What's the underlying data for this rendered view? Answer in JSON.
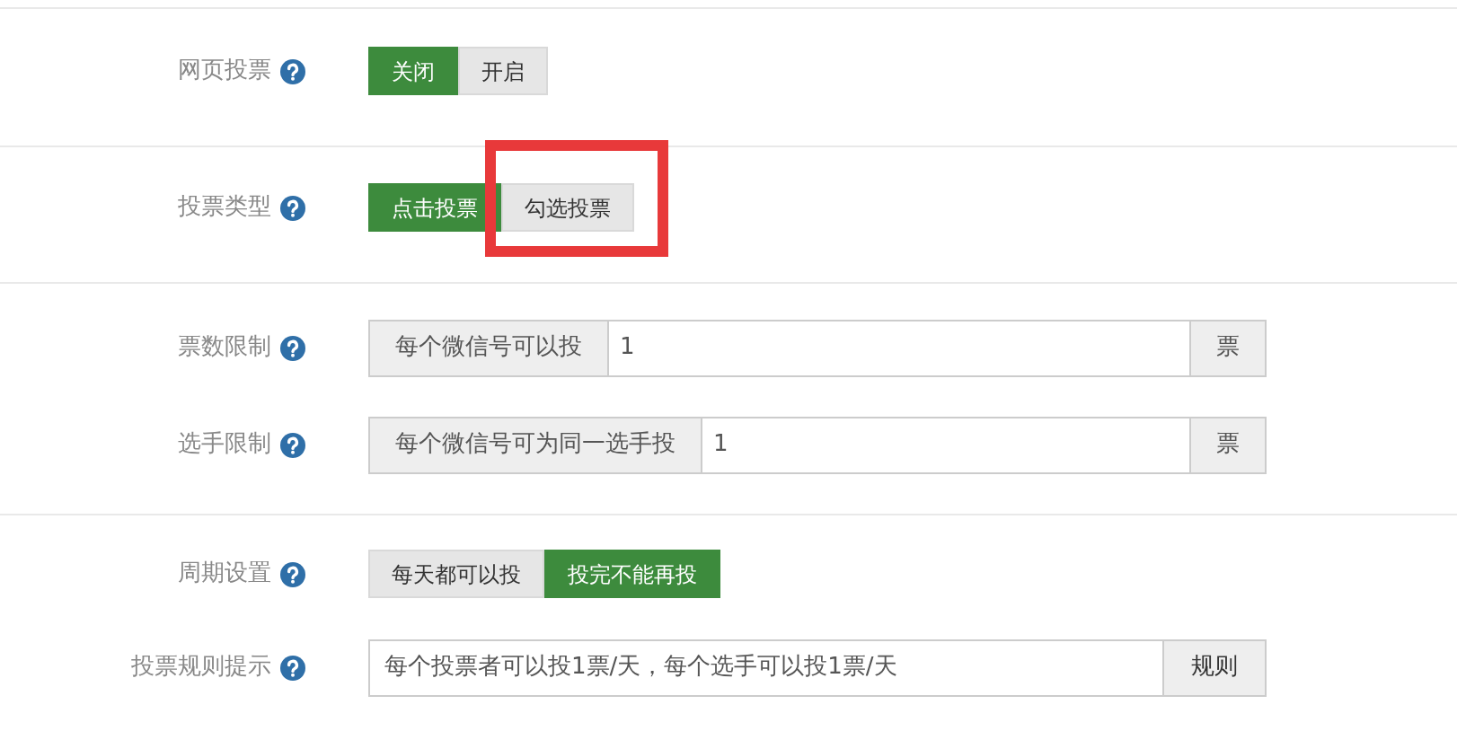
{
  "sections": [
    {
      "rows": [
        {
          "kind": "toggle",
          "label": "网页投票",
          "options": [
            {
              "label": "关闭",
              "selected": true,
              "highlighted": false
            },
            {
              "label": "开启",
              "selected": false,
              "highlighted": false
            }
          ]
        }
      ]
    },
    {
      "rows": [
        {
          "kind": "toggle",
          "label": "投票类型",
          "options": [
            {
              "label": "点击投票",
              "selected": true,
              "highlighted": false
            },
            {
              "label": "勾选投票",
              "selected": false,
              "highlighted": true
            }
          ]
        }
      ]
    },
    {
      "rows": [
        {
          "kind": "input_group",
          "label": "票数限制",
          "prefix": "每个微信号可以投",
          "value": "1",
          "suffix": "票"
        },
        {
          "kind": "input_group",
          "label": "选手限制",
          "prefix": "每个微信号可为同一选手投",
          "value": "1",
          "suffix": "票"
        }
      ]
    },
    {
      "rows": [
        {
          "kind": "toggle",
          "label": "周期设置",
          "options": [
            {
              "label": "每天都可以投",
              "selected": false,
              "highlighted": false
            },
            {
              "label": "投完不能再投",
              "selected": true,
              "highlighted": false
            }
          ]
        },
        {
          "kind": "text_button",
          "label": "投票规则提示",
          "value": "每个投票者可以投1票/天，每个选手可以投1票/天",
          "button": "规则"
        }
      ]
    }
  ]
}
